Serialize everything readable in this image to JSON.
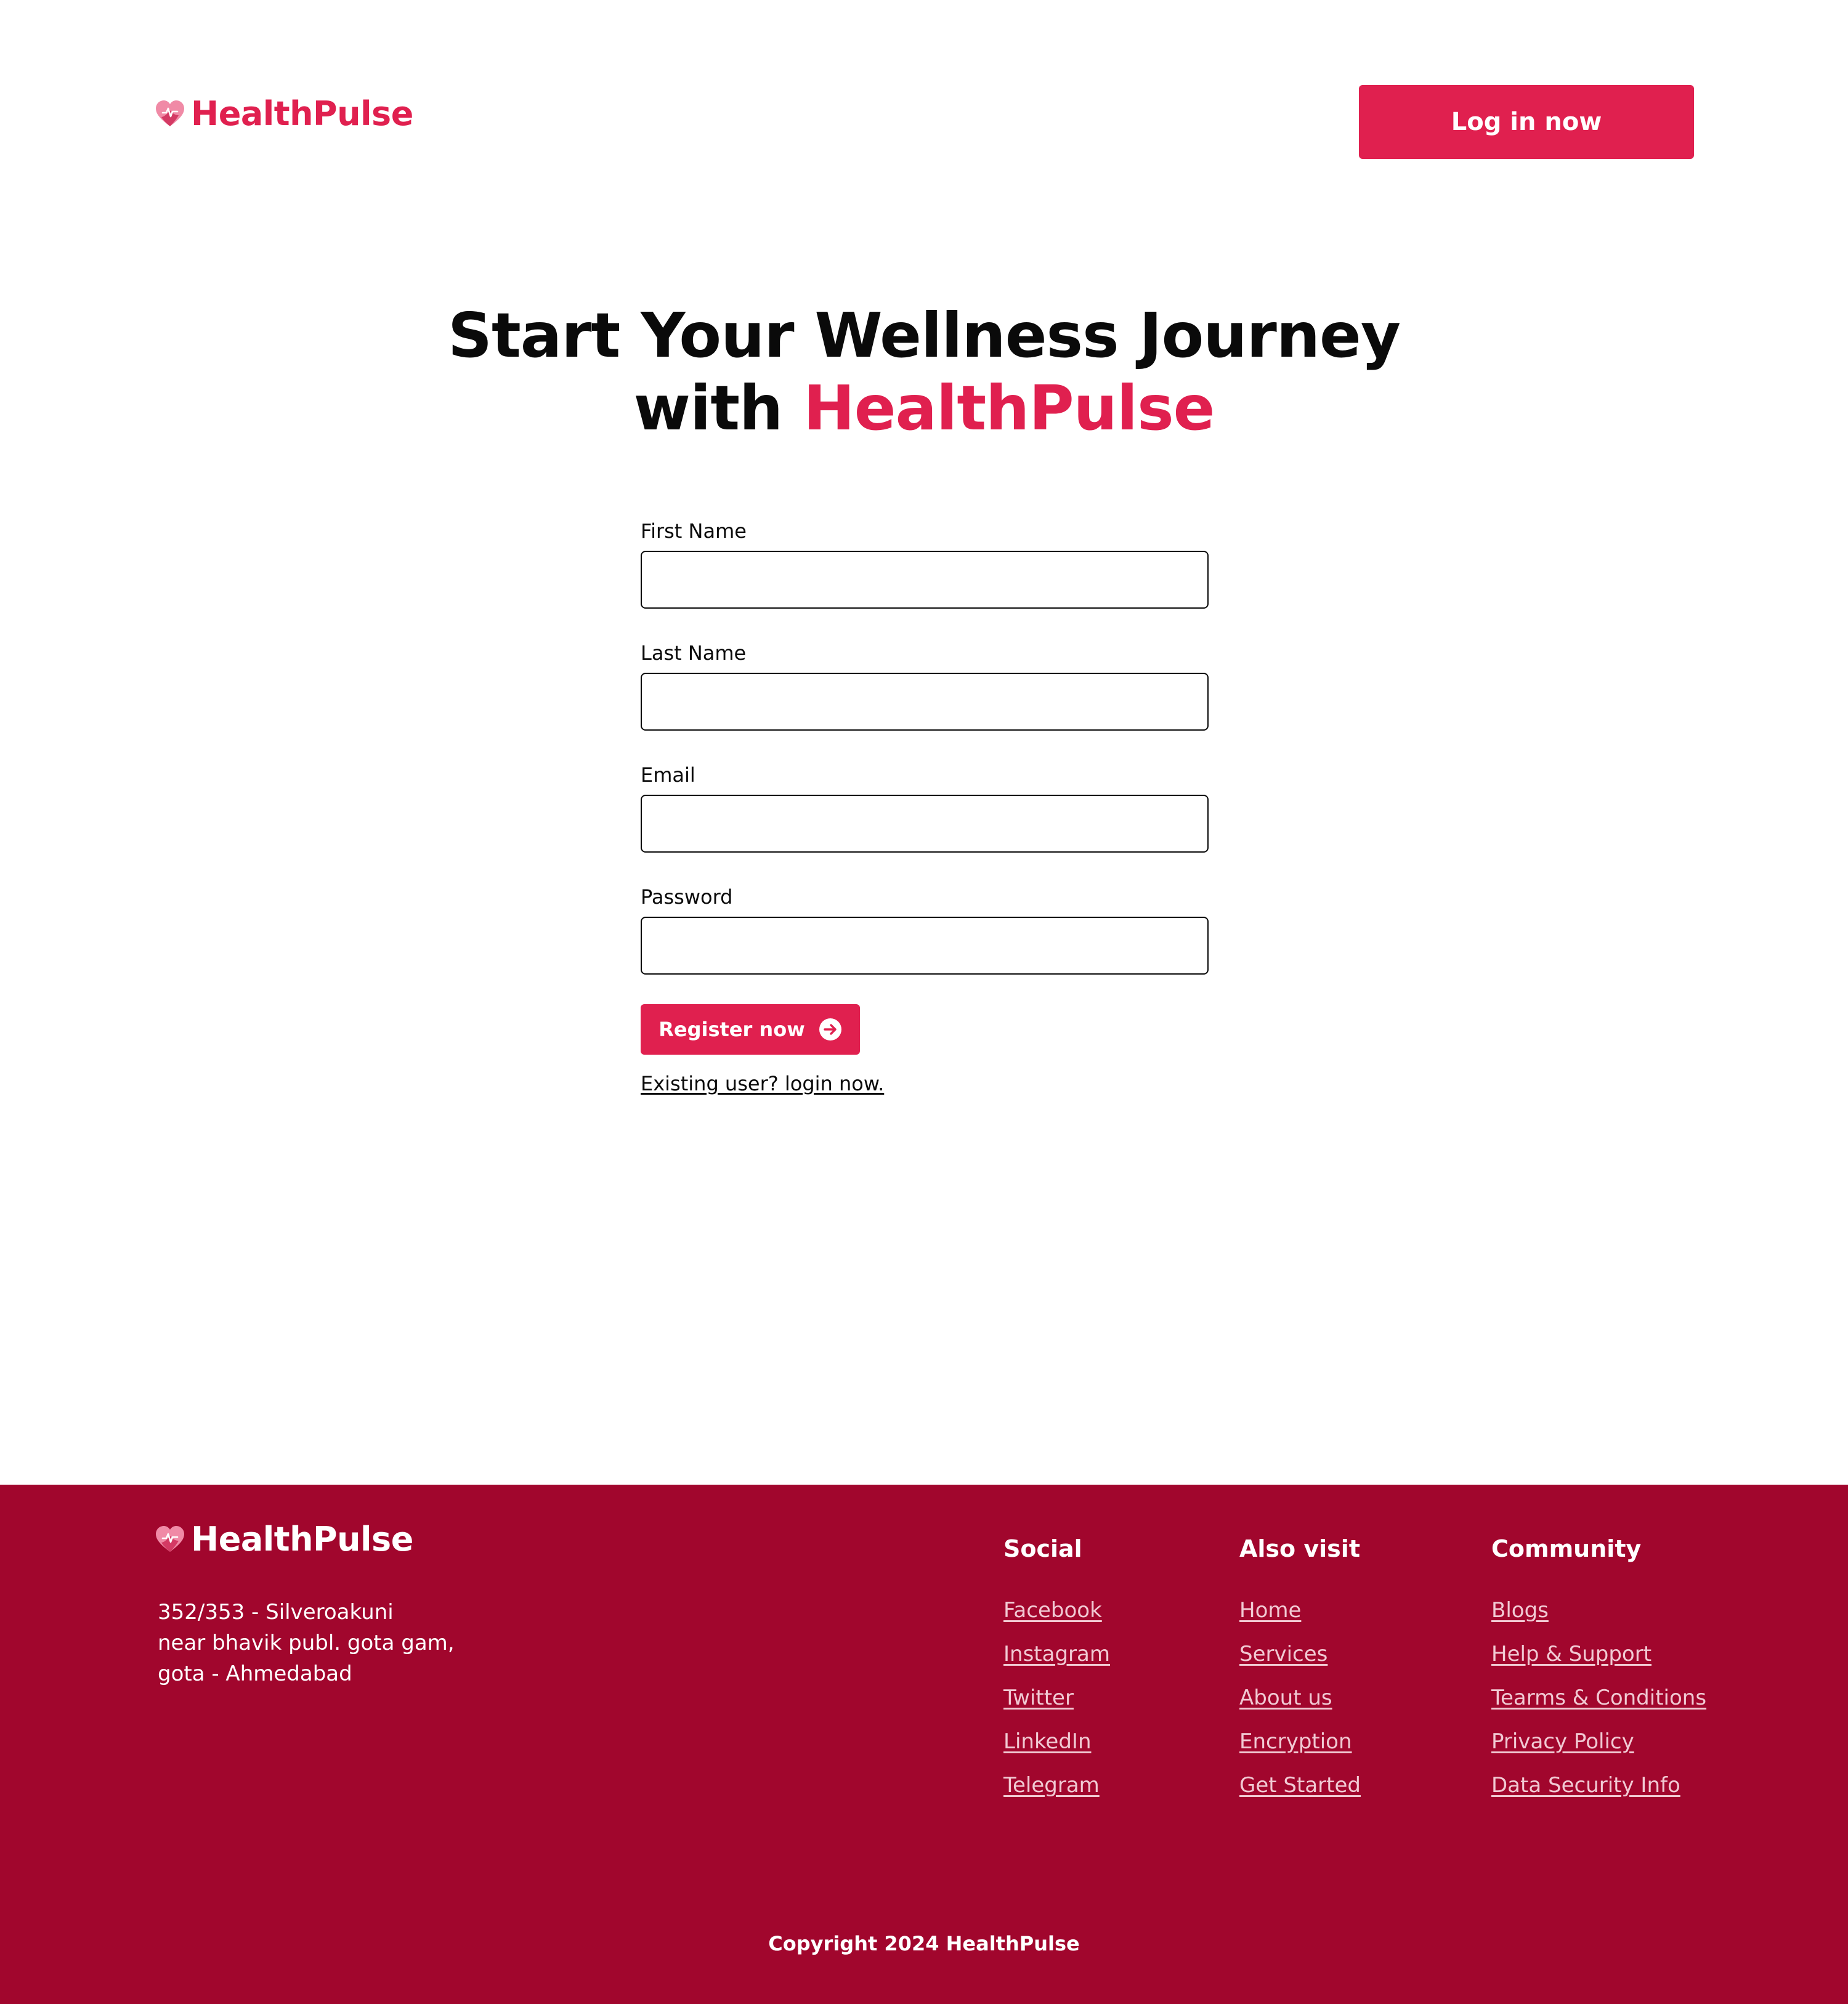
{
  "brand": {
    "name": "HealthPulse",
    "accent_color": "#e0204f",
    "footer_color": "#a1062d"
  },
  "header": {
    "login_button_label": "Log in now"
  },
  "hero": {
    "line1": "Start Your Wellness Journey",
    "line2_prefix": "with ",
    "line2_accent": "HealthPulse"
  },
  "form": {
    "fields": [
      {
        "label": "First Name",
        "value": ""
      },
      {
        "label": "Last Name",
        "value": ""
      },
      {
        "label": "Email",
        "value": ""
      },
      {
        "label": "Password",
        "value": ""
      }
    ],
    "submit_label": "Register now",
    "submit_icon": "arrow-right-circle-icon",
    "login_link": "Existing user? login now."
  },
  "footer": {
    "address": [
      "352/353 - Silveroakuni",
      "near bhavik publ. gota gam,",
      "gota - Ahmedabad"
    ],
    "columns": [
      {
        "heading": "Social",
        "links": [
          "Facebook",
          "Instagram",
          "Twitter",
          "LinkedIn",
          "Telegram"
        ]
      },
      {
        "heading": "Also visit",
        "links": [
          "Home",
          "Services",
          "About us",
          "Encryption",
          "Get Started"
        ]
      },
      {
        "heading": "Community",
        "links": [
          "Blogs",
          "Help & Support",
          "Tearms & Conditions",
          "Privacy Policy",
          "Data Security Info"
        ]
      }
    ],
    "copyright": "Copyright 2024 HealthPulse"
  }
}
